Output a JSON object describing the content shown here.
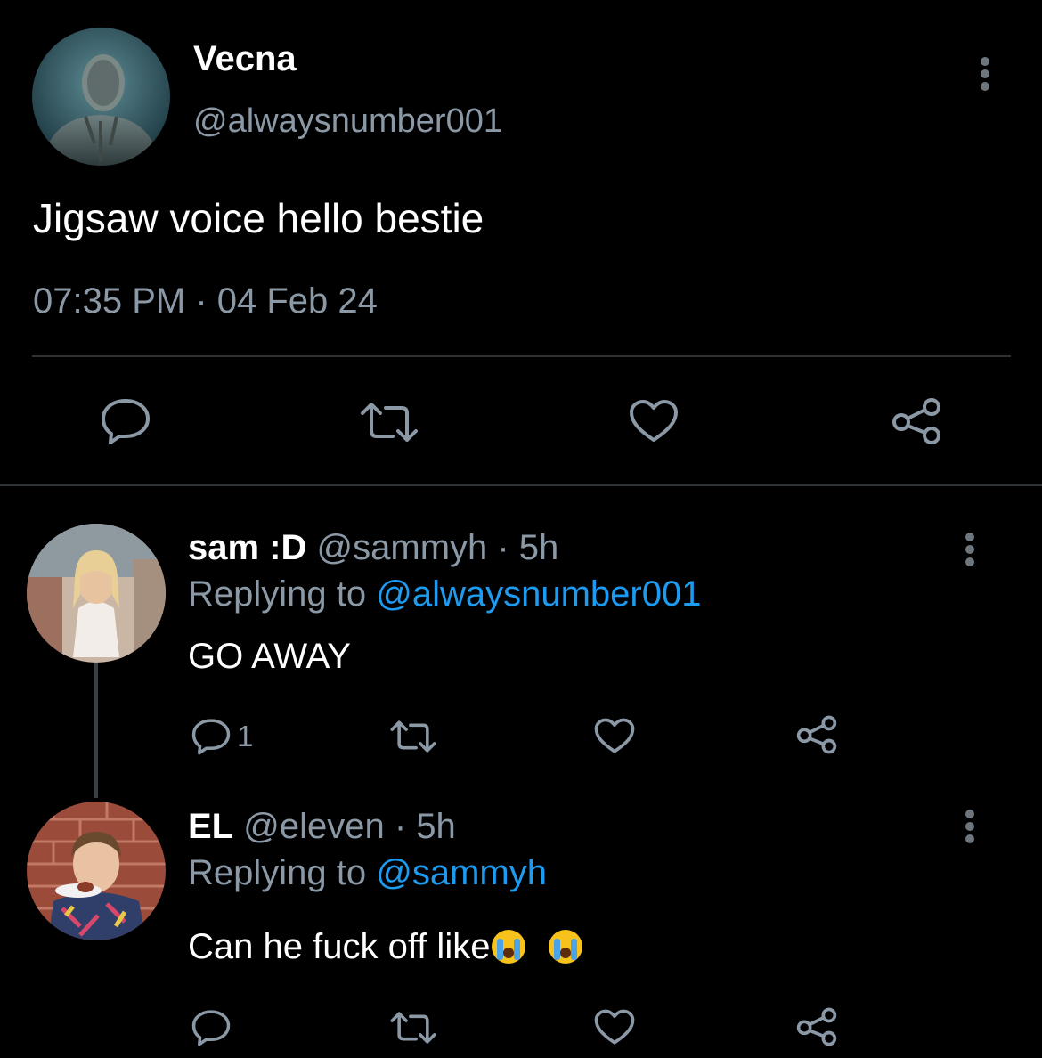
{
  "main_tweet": {
    "name": "Vecna",
    "handle": "@alwaysnumber001",
    "text": "Jigsaw voice hello bestie",
    "timestamp": "07:35 PM · 04 Feb 24",
    "avatar_icon": "vecna-avatar"
  },
  "replies": [
    {
      "name": "sam :D",
      "handle_time": "@sammyh · 5h",
      "replying_prefix": "Replying to ",
      "replying_to": "@alwaysnumber001",
      "text": "GO AWAY",
      "reply_count": "1",
      "avatar_icon": "sam-avatar"
    },
    {
      "name": "EL",
      "handle_time": "@eleven · 5h",
      "replying_prefix": "Replying to ",
      "replying_to": "@sammyh",
      "text": "Can he fuck off like",
      "emojis": [
        "loudly-crying-face",
        "loudly-crying-face"
      ],
      "reply_count": "",
      "avatar_icon": "el-avatar"
    }
  ],
  "colors": {
    "background": "#000000",
    "secondary_text": "#8b98a5",
    "mention": "#1d9bf0",
    "divider": "#2f3336"
  }
}
